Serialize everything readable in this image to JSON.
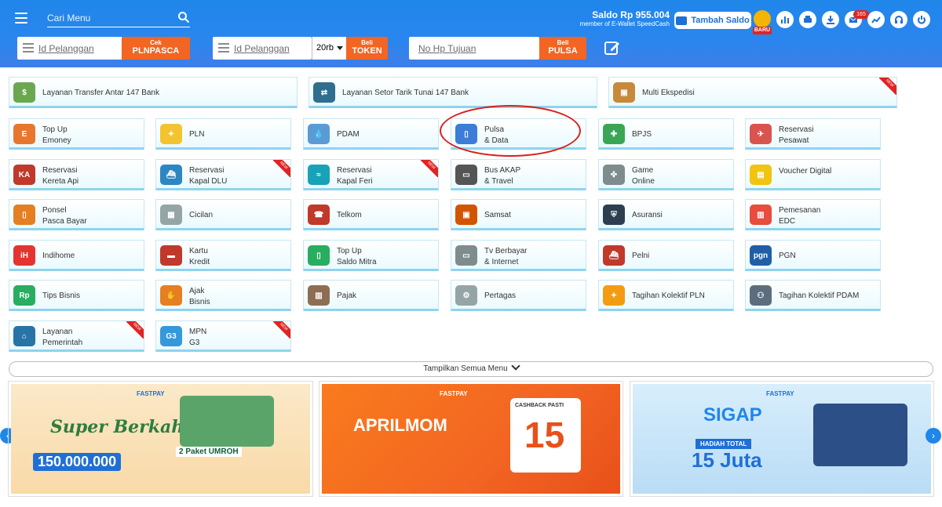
{
  "header": {
    "search_placeholder": "Cari Menu",
    "saldo": "Saldo Rp 955.004",
    "member": "member of E-Wallet SpeedCash",
    "tambah_saldo": "Tambah Saldo",
    "baru": "BARU",
    "notif_count": "165"
  },
  "quick": {
    "pln": {
      "placeholder": "Id Pelanggan",
      "btn_top": "Cek",
      "btn_main": "PLNPASCA"
    },
    "token": {
      "placeholder": "Id Pelanggan",
      "nominal": "20rb",
      "btn_top": "Beli",
      "btn_main": "TOKEN"
    },
    "pulsa": {
      "placeholder": "No Hp Tujuan",
      "btn_top": "Beli",
      "btn_main": "PULSA"
    }
  },
  "menu": {
    "wide": [
      {
        "label": "Layanan Transfer Antar 147 Bank"
      },
      {
        "label": "Layanan Setor Tarik Tunai 147 Bank"
      },
      {
        "label": "Multi Ekspedisi"
      }
    ],
    "items": [
      {
        "label": "Top Up\nEmoney"
      },
      {
        "label": "PLN"
      },
      {
        "label": "PDAM"
      },
      {
        "label": "Pulsa\n& Data"
      },
      {
        "label": "BPJS"
      },
      {
        "label": "Reservasi\nPesawat"
      },
      {
        "label": "Reservasi\nKereta Api"
      },
      {
        "label": "Reservasi\nKapal DLU"
      },
      {
        "label": "Reservasi\nKapal Feri"
      },
      {
        "label": "Bus AKAP\n& Travel"
      },
      {
        "label": "Game\nOnline"
      },
      {
        "label": "Voucher Digital"
      },
      {
        "label": "Ponsel\nPasca Bayar"
      },
      {
        "label": "Cicilan"
      },
      {
        "label": "Telkom"
      },
      {
        "label": "Samsat"
      },
      {
        "label": "Asuransi"
      },
      {
        "label": "Pemesanan\nEDC"
      },
      {
        "label": "Indihome"
      },
      {
        "label": "Kartu\nKredit"
      },
      {
        "label": "Top Up\nSaldo Mitra"
      },
      {
        "label": "Tv Berbayar\n& Internet"
      },
      {
        "label": "Pelni"
      },
      {
        "label": "PGN"
      },
      {
        "label": "Tips Bisnis"
      },
      {
        "label": "Ajak\nBisnis"
      },
      {
        "label": "Pajak"
      },
      {
        "label": "Pertagas"
      },
      {
        "label": "Tagihan Kolektif PLN"
      },
      {
        "label": "Tagihan Kolektif PDAM"
      },
      {
        "label": "Layanan\nPemerintah"
      },
      {
        "label": "MPN\nG3"
      }
    ],
    "new_label": "NEW",
    "show_all": "Tampilkan Semua Menu"
  },
  "banners": [
    {
      "brand": "FASTPAY",
      "title": "Super Berkah",
      "sub": "2 Paket UMROH",
      "amount": "150.000.000"
    },
    {
      "brand": "FASTPAY",
      "title": "APRILMOM",
      "sub": "CASHBACK PASTI",
      "amount": "15"
    },
    {
      "brand": "FASTPAY",
      "title": "SIGAP",
      "sub": "HADIAH TOTAL",
      "amount": "15 Juta"
    }
  ],
  "colors": {
    "primary": "#1f86ea",
    "accent": "#f26522",
    "new": "#e02424"
  }
}
